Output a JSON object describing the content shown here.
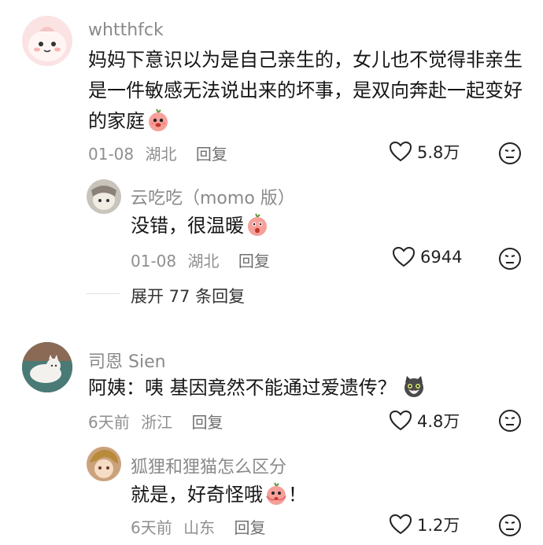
{
  "comments": [
    {
      "username": "whtthfck",
      "text_lines": [
        "妈妈下意识以为是自己亲生的，女儿也不觉得非亲生",
        "是一件敏感无法说出来的坏事，是双向奔赴一起变好",
        "的家庭"
      ],
      "date": "01-08",
      "location": "湖北",
      "reply_label": "回复",
      "likes": "5.8万",
      "reply": {
        "username": "云吃吃（momo 版）",
        "text": "没错，很温暖",
        "date": "01-08",
        "location": "湖北",
        "reply_label": "回复",
        "likes": "6944"
      },
      "expand_label": "展开 77 条回复"
    },
    {
      "username": "司恩 Sien",
      "text": "阿姨：咦 基因竟然不能通过爱遗传？",
      "date": "6天前",
      "location": "浙江",
      "reply_label": "回复",
      "likes": "4.8万",
      "reply": {
        "username": "狐狸和狸猫怎么区分",
        "text": "就是，好奇怪哦",
        "text_suffix": "！",
        "date": "6天前",
        "location": "山东",
        "reply_label": "回复",
        "likes": "1.2万"
      }
    }
  ],
  "icons": [
    "heart-icon",
    "dislike-face-icon",
    "peach-emoji",
    "cat-emoji"
  ],
  "colors": {
    "meta": "#8f8f8f",
    "username": "#8a8a8a",
    "text": "#161616",
    "peach": "#f6a09a"
  }
}
